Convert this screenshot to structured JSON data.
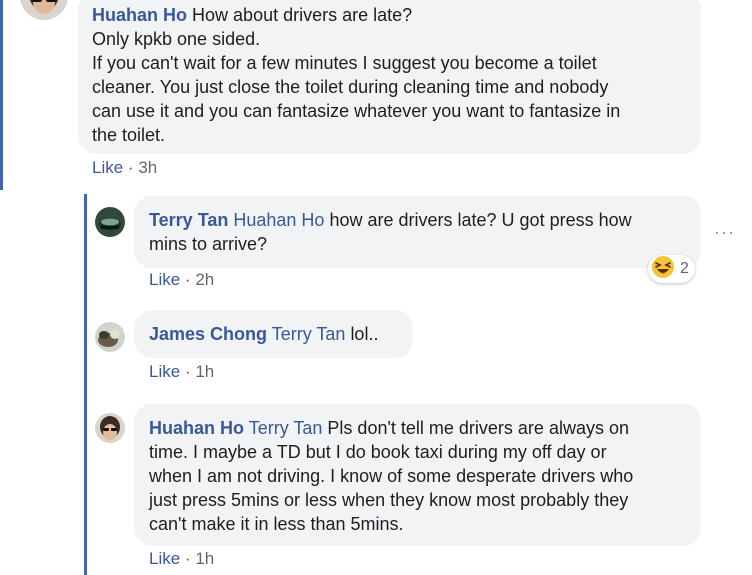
{
  "comments": [
    {
      "author": "Huahan Ho",
      "lines": [
        "How about drivers are late?",
        "Only kpkb one sided.",
        "If you can't wait for a few minutes I suggest you become a toilet",
        "cleaner. You just close the toilet during cleaning time and nobody",
        "can use it and you can fantasize whatever you want to fantasize in",
        "the toilet."
      ],
      "like_label": "Like",
      "separator": "·",
      "time": "3h"
    },
    {
      "author": "Terry Tan",
      "mention": "Huahan Ho",
      "lines": [
        "how are drivers late? U got press how",
        "mins to arrive?"
      ],
      "like_label": "Like",
      "separator": "·",
      "time": "2h",
      "reaction": {
        "icon": "laughing-emoji-icon",
        "count": "2"
      }
    },
    {
      "author": "James Chong",
      "mention": "Terry Tan",
      "lines": [
        "lol.."
      ],
      "like_label": "Like",
      "separator": "·",
      "time": "1h"
    },
    {
      "author": "Huahan Ho",
      "mention": "Terry Tan",
      "lines": [
        "Pls don't tell me drivers are always on",
        "time. I maybe a TD but I do book taxi during my off day or",
        "when I am not driving. I know of some desperate drivers who",
        "just press 5mins or less when they know most probably they",
        "can't make it in less than 5mins."
      ],
      "like_label": "Like",
      "separator": "·",
      "time": "1h"
    }
  ],
  "more_options": "···",
  "colors": {
    "link": "#385898",
    "bubble": "#f2f3f5",
    "thread_line": "#4267b2",
    "meta_text": "#606770"
  }
}
